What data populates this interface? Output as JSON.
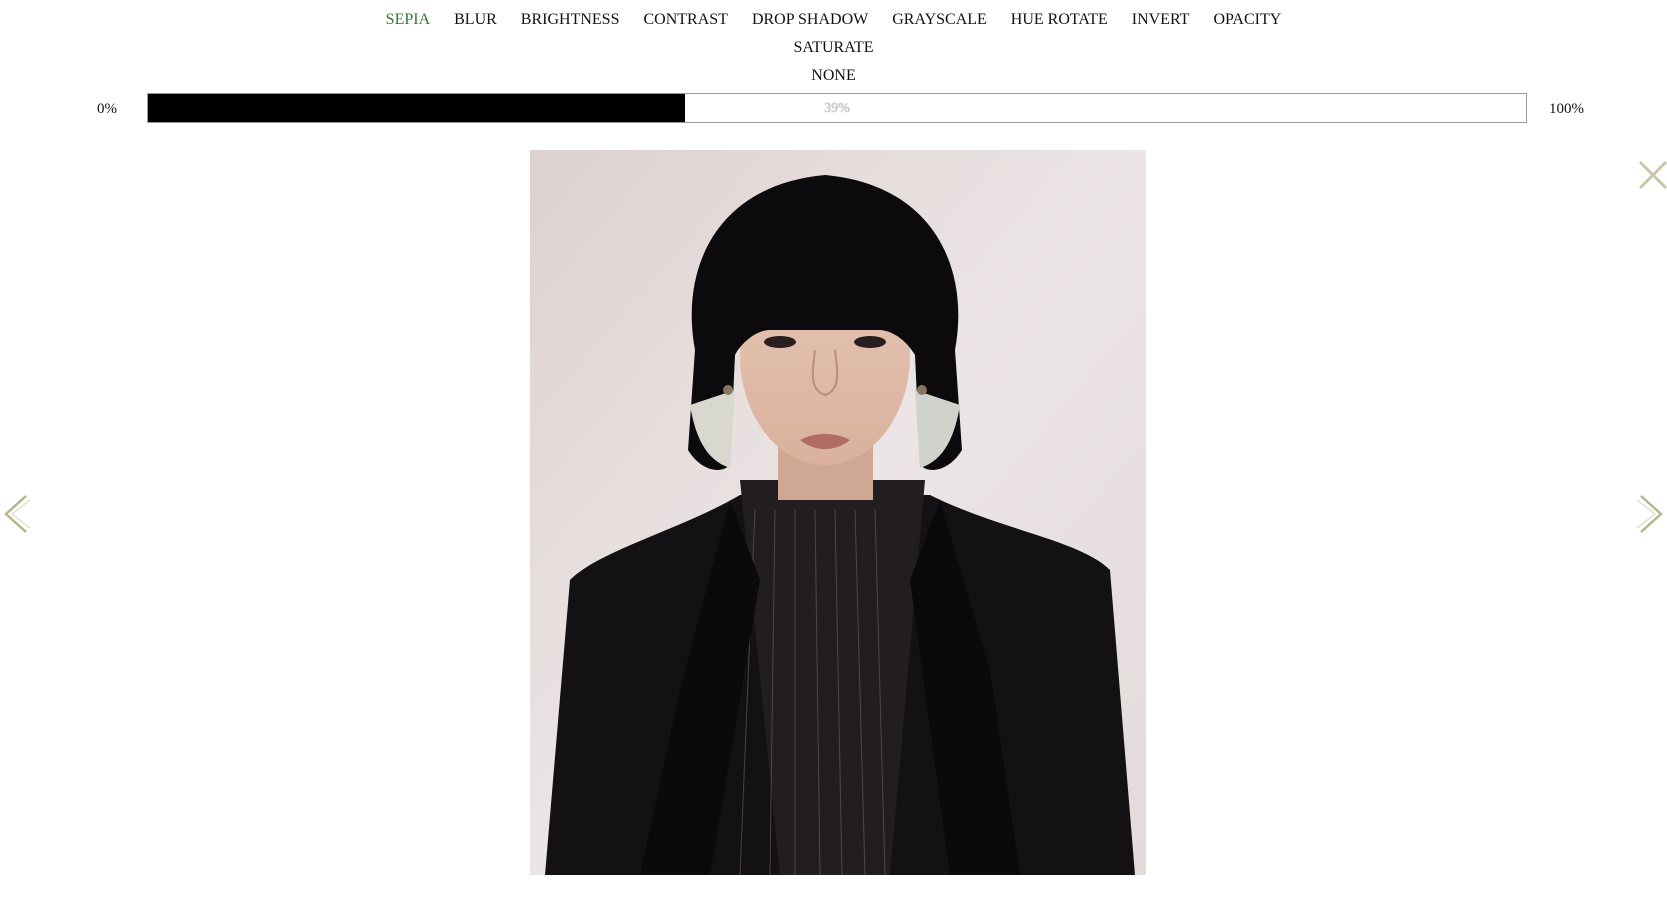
{
  "filters": {
    "row1": [
      "SEPIA",
      "BLUR",
      "BRIGHTNESS",
      "CONTRAST",
      "DROP SHADOW",
      "GRAYSCALE",
      "HUE ROTATE",
      "INVERT",
      "OPACITY"
    ],
    "row2": [
      "SATURATE"
    ],
    "row3": [
      "NONE"
    ],
    "active": "SEPIA",
    "active_color": "#2e7d32"
  },
  "progress": {
    "min_label": "0%",
    "max_label": "100%",
    "value_label": "39%",
    "value": 0.39
  },
  "icons": {
    "prev": "chevron-left-icon",
    "next": "chevron-right-icon",
    "close": "close-icon"
  }
}
